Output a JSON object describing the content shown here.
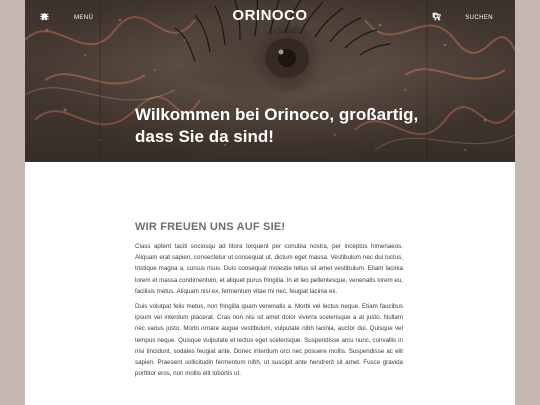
{
  "header": {
    "menu_label": "MENÜ",
    "logo": "ORINOCO",
    "search_label": "SUCHEN",
    "icons": [
      "home-icon",
      "menu-icon",
      "cart-icon",
      "search-icon"
    ]
  },
  "hero": {
    "title": "Wilkommen bei Orinoco, großartig, dass Sie da sind!"
  },
  "main": {
    "heading": "WIR FREUEN UNS AUF SIE!",
    "paragraphs": [
      "Class aptent taciti sociosqu ad litora torquent per conubia nostra, per inceptos himenaeos. Aliquam erat sapien, consectetur ut consequat ut, dictum eget massa. Vestibulum nec dui luctus, tristique magna a, cursus risus. Duis consequat molestie tellus sit amet vestibulum. Etiam lacinia lorem et massa condimentum, et aliquet purus fringilla. In et leo pellentesque, venenatis lorem eu, facilisis metus. Aliquam nisi ex, fermentum vitae mi nec, feugiat lacinia ex.",
      "Duis volutpat felis metus, non fringilla quam venenatis a. Morbi vel lectus neque. Etiam faucibus ipsum vel interdum placerat. Cras non nisi sit amet dolor viverra scelerisque a at justo. Nullam nec varius justo. Morbi ornare augue vestibulum, vulputate nibh lacinia, auctor dui. Quisque vel tempus neque. Quisque vulputate et lectus eget scelerisque. Suspendisse arcu nunc, convallis in nisi tincidunt, sodales feugiat ante. Donec interdum orci nec posuere mollis. Suspendisse ac elit sapien. Praesent sollicitudin fermentum nibh, ut suscipit ante hendrerit sit amet. Fusce gravida porttitor eros, non mollis elit lobortis ut."
    ]
  },
  "colors": {
    "side_background": "#c5b8b3",
    "page_background": "#ffffff",
    "heading": "#6e6e6e",
    "body_text": "#3c3c3c"
  }
}
